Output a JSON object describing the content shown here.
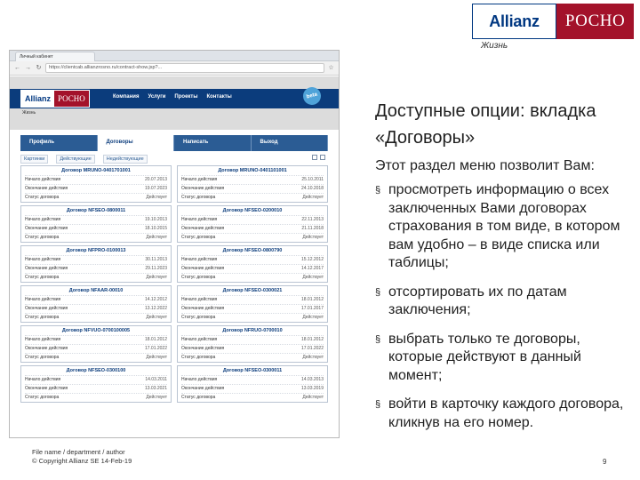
{
  "logo": {
    "brand": "Allianz",
    "partner": "РОСНО",
    "subtitle": "Жизнь"
  },
  "browser": {
    "tab_title": "Личный кабинет",
    "url": "https://clientcab.allianzrosno.ru/contract-show.jsp?...",
    "site": {
      "logo_brand": "Allianz",
      "logo_partner": "РОСНО",
      "logo_subtitle": "Жизнь",
      "nav": [
        "Компания",
        "Услуги",
        "Проекты",
        "Контакты"
      ],
      "beta_badge": "beta",
      "tabs": [
        "Профиль",
        "Договоры",
        "Написать",
        "Выход"
      ],
      "active_tab": 1,
      "filters": [
        "Картинки",
        "Действующие",
        "Недействующие"
      ],
      "cards": [
        {
          "title": "Договор MRUNO-0401701001",
          "rows": [
            [
              "Начало действия",
              "20.07.2013"
            ],
            [
              "Окончание действия",
              "19.07.2023"
            ],
            [
              "Статус договора",
              "Действует"
            ]
          ]
        },
        {
          "title": "Договор MRUNO-0401101001",
          "rows": [
            [
              "Начало действия",
              "25.10.2011"
            ],
            [
              "Окончание действия",
              "24.10.2018"
            ],
            [
              "Статус договора",
              "Действует"
            ]
          ]
        },
        {
          "title": "Договор NFSEO-0800011",
          "rows": [
            [
              "Начало действия",
              "19.10.2013"
            ],
            [
              "Окончание действия",
              "18.10.2015"
            ],
            [
              "Статус договора",
              "Действует"
            ]
          ]
        },
        {
          "title": "Договор NFSEO-0200010",
          "rows": [
            [
              "Начало действия",
              "22.11.2013"
            ],
            [
              "Окончание действия",
              "21.11.2018"
            ],
            [
              "Статус договора",
              "Действует"
            ]
          ]
        },
        {
          "title": "Договор NFPRO-0100013",
          "rows": [
            [
              "Начало действия",
              "30.11.2013"
            ],
            [
              "Окончание действия",
              "29.11.2023"
            ],
            [
              "Статус договора",
              "Действует"
            ]
          ]
        },
        {
          "title": "Договор NFSEO-0800790",
          "rows": [
            [
              "Начало действия",
              "15.12.2012"
            ],
            [
              "Окончание действия",
              "14.12.2017"
            ],
            [
              "Статус договора",
              "Действует"
            ]
          ]
        },
        {
          "title": "Договор NFAAR-00010",
          "rows": [
            [
              "Начало действия",
              "14.12.2012"
            ],
            [
              "Окончание действия",
              "13.12.2022"
            ],
            [
              "Статус договора",
              "Действует"
            ]
          ]
        },
        {
          "title": "Договор NFSEO-0300021",
          "rows": [
            [
              "Начало действия",
              "18.01.2012"
            ],
            [
              "Окончание действия",
              "17.01.2017"
            ],
            [
              "Статус договора",
              "Действует"
            ]
          ]
        },
        {
          "title": "Договор NFVUO-0700100005",
          "rows": [
            [
              "Начало действия",
              "18.01.2012"
            ],
            [
              "Окончание действия",
              "17.01.2022"
            ],
            [
              "Статус договора",
              "Действует"
            ]
          ]
        },
        {
          "title": "Договор NFRUO-0700010",
          "rows": [
            [
              "Начало действия",
              "18.01.2012"
            ],
            [
              "Окончание действия",
              "17.01.2022"
            ],
            [
              "Статус договора",
              "Действует"
            ]
          ]
        },
        {
          "title": "Договор NFSEO-0300100",
          "rows": [
            [
              "Начало действия",
              "14.03.2011"
            ],
            [
              "Окончание действия",
              "13.03.2021"
            ],
            [
              "Статус договора",
              "Действует"
            ]
          ]
        },
        {
          "title": "Договор NFSEO-0300011",
          "rows": [
            [
              "Начало действия",
              "14.03.2013"
            ],
            [
              "Окончание действия",
              "13.03.2019"
            ],
            [
              "Статус договора",
              "Действует"
            ]
          ]
        }
      ]
    }
  },
  "heading": "Доступные опции: вкладка «Договоры»",
  "intro": "Этот раздел меню позволит Вам:",
  "bullets": [
    "просмотреть информацию о всех заключенных Вами договорах страхования в том виде, в котором вам удобно – в виде списка или таблицы;",
    "отсортировать их по датам заключения;",
    "выбрать только те договоры, которые действуют в данный момент;",
    "войти в карточку каждого договора, кликнув на его номер."
  ],
  "bullet_marker": "§",
  "footer": {
    "line1": "File name / department / author",
    "line2": "© Copyright Allianz SE 14-Feb-19"
  },
  "page_number": "9",
  "colors": {
    "allianz_blue": "#003781",
    "rosno_red": "#a3122a",
    "site_nav_blue": "#0b3c7c"
  }
}
